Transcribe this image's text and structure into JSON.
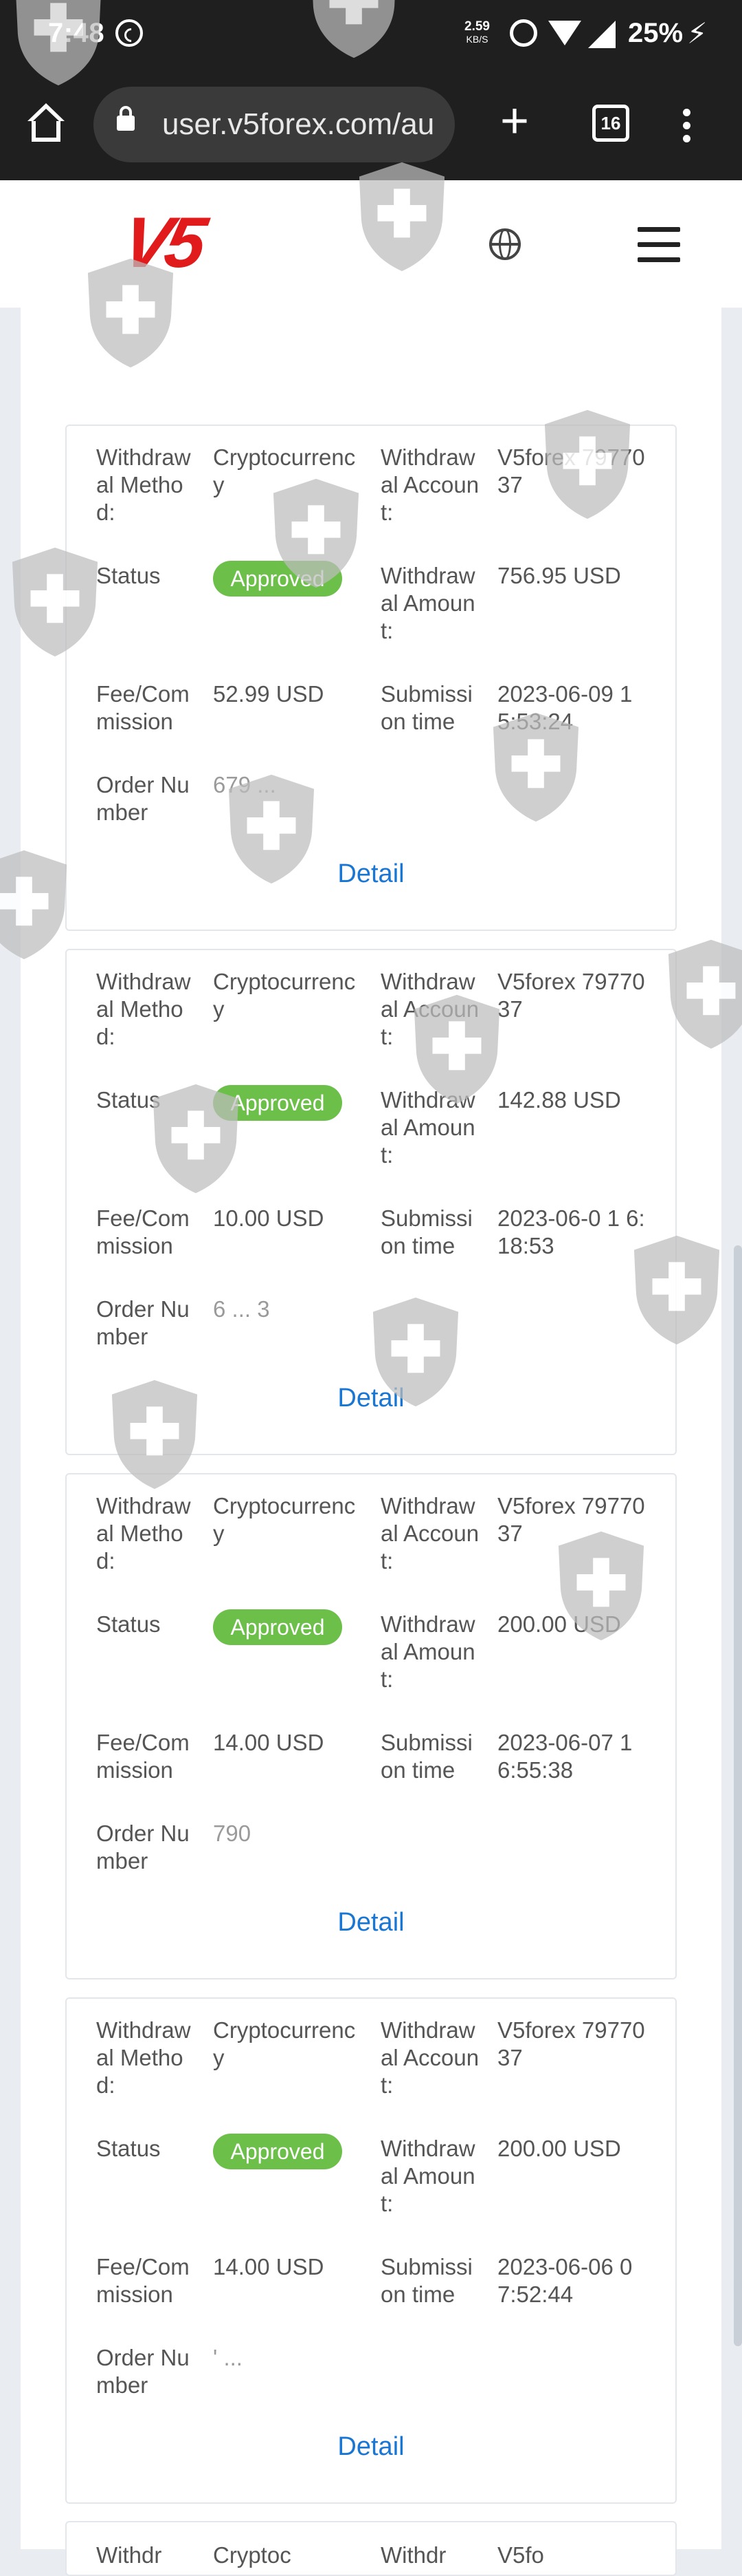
{
  "status_bar": {
    "time": "7:48",
    "net_speed": "2.59",
    "net_unit": "KB/S",
    "battery": "25%"
  },
  "browser": {
    "url": "user.v5forex.com/au",
    "tab_count": "16"
  },
  "site": {
    "logo": "V5"
  },
  "labels": {
    "method": "Withdraw al Metho d:",
    "status": "Status",
    "fee": "Fee/Com mission",
    "order": "Order Nu mber",
    "account": "Withdraw al Accoun t:",
    "amount": "Withdraw al Amoun t:",
    "submission": "Submissi on time",
    "detail": "Detail"
  },
  "records": [
    {
      "method": "Cryptocurrenc y",
      "status": "Approved",
      "fee": "52.99 USD",
      "order": "679 ...",
      "account": "V5forex 7977037",
      "amount": "756.95 USD",
      "submission": "2023-06-09 1 5:53:24"
    },
    {
      "method": "Cryptocurrenc y",
      "status": "Approved",
      "fee": "10.00 USD",
      "order": "6 ... 3",
      "account": "V5forex 7977037",
      "amount": "142.88 USD",
      "submission": "2023-06-0 1 6:18:53"
    },
    {
      "method": "Cryptocurrenc y",
      "status": "Approved",
      "fee": "14.00 USD",
      "order": "790",
      "account": "V5forex 7977037",
      "amount": "200.00 USD",
      "submission": "2023-06-07 1 6:55:38"
    },
    {
      "method": "Cryptocurrenc y",
      "status": "Approved",
      "fee": "14.00 USD",
      "order": "' ...",
      "account": "V5forex 7977037",
      "amount": "200.00 USD",
      "submission": "2023-06-06 0 7:52:44"
    }
  ],
  "partial_card": {
    "label_left": "Withdr",
    "value_left": "Cryptoc",
    "label_right": "Withdr",
    "value_right": "V5fo"
  },
  "colors": {
    "approved": "#6cc04a",
    "link": "#1976d2",
    "brand": "#e11b1b"
  }
}
